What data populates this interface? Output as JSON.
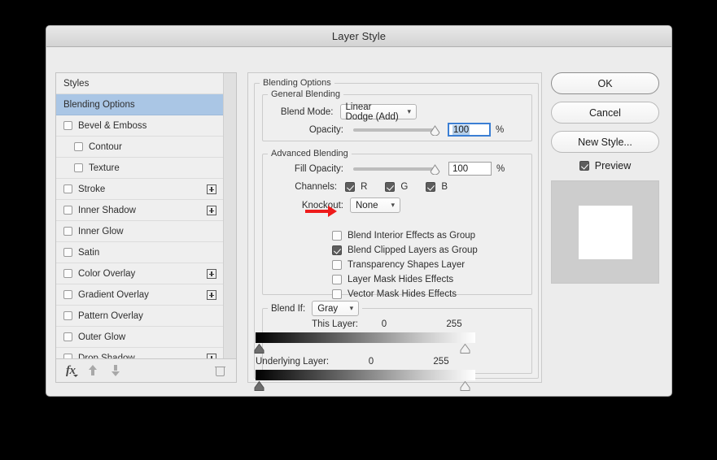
{
  "window": {
    "title": "Layer Style"
  },
  "sidebar": {
    "items": [
      {
        "label": "Styles",
        "type": "plain",
        "selected": false,
        "checkbox": false,
        "plus": false,
        "indent": false
      },
      {
        "label": "Blending Options",
        "type": "plain",
        "selected": true,
        "checkbox": false,
        "plus": false,
        "indent": false
      },
      {
        "label": "Bevel & Emboss",
        "type": "effect",
        "selected": false,
        "checkbox": true,
        "checked": false,
        "plus": false,
        "indent": false
      },
      {
        "label": "Contour",
        "type": "effect",
        "selected": false,
        "checkbox": true,
        "checked": false,
        "plus": false,
        "indent": true
      },
      {
        "label": "Texture",
        "type": "effect",
        "selected": false,
        "checkbox": true,
        "checked": false,
        "plus": false,
        "indent": true
      },
      {
        "label": "Stroke",
        "type": "effect",
        "selected": false,
        "checkbox": true,
        "checked": false,
        "plus": true,
        "indent": false
      },
      {
        "label": "Inner Shadow",
        "type": "effect",
        "selected": false,
        "checkbox": true,
        "checked": false,
        "plus": true,
        "indent": false
      },
      {
        "label": "Inner Glow",
        "type": "effect",
        "selected": false,
        "checkbox": true,
        "checked": false,
        "plus": false,
        "indent": false
      },
      {
        "label": "Satin",
        "type": "effect",
        "selected": false,
        "checkbox": true,
        "checked": false,
        "plus": false,
        "indent": false
      },
      {
        "label": "Color Overlay",
        "type": "effect",
        "selected": false,
        "checkbox": true,
        "checked": false,
        "plus": true,
        "indent": false
      },
      {
        "label": "Gradient Overlay",
        "type": "effect",
        "selected": false,
        "checkbox": true,
        "checked": false,
        "plus": true,
        "indent": false
      },
      {
        "label": "Pattern Overlay",
        "type": "effect",
        "selected": false,
        "checkbox": true,
        "checked": false,
        "plus": false,
        "indent": false
      },
      {
        "label": "Outer Glow",
        "type": "effect",
        "selected": false,
        "checkbox": true,
        "checked": false,
        "plus": false,
        "indent": false
      },
      {
        "label": "Drop Shadow",
        "type": "effect",
        "selected": false,
        "checkbox": true,
        "checked": false,
        "plus": true,
        "indent": false
      }
    ],
    "toolbar": {
      "fx_label": "fx",
      "move_up_label": "Move Up",
      "move_down_label": "Move Down",
      "delete_label": "Delete Effect"
    }
  },
  "blending_options": {
    "group_label": "Blending Options",
    "general": {
      "group_label": "General Blending",
      "blend_mode_label": "Blend Mode:",
      "blend_mode_value": "Linear Dodge (Add)",
      "opacity_label": "Opacity:",
      "opacity_value": "100",
      "opacity_unit": "%",
      "opacity_slider_pct": 100
    },
    "advanced": {
      "group_label": "Advanced Blending",
      "fill_opacity_label": "Fill Opacity:",
      "fill_opacity_value": "100",
      "fill_opacity_unit": "%",
      "fill_opacity_slider_pct": 100,
      "channels_label": "Channels:",
      "channels": [
        {
          "label": "R",
          "checked": true
        },
        {
          "label": "G",
          "checked": true
        },
        {
          "label": "B",
          "checked": true
        }
      ],
      "knockout_label": "Knockout:",
      "knockout_value": "None",
      "options": [
        {
          "label": "Blend Interior Effects as Group",
          "checked": false,
          "annotated": false
        },
        {
          "label": "Blend Clipped Layers as Group",
          "checked": true,
          "annotated": false
        },
        {
          "label": "Transparency Shapes Layer",
          "checked": false,
          "annotated": true
        },
        {
          "label": "Layer Mask Hides Effects",
          "checked": false,
          "annotated": false
        },
        {
          "label": "Vector Mask Hides Effects",
          "checked": false,
          "annotated": false
        }
      ]
    },
    "blend_if": {
      "group_label": "Blend If:",
      "channel_value": "Gray",
      "this_layer": {
        "label": "This Layer:",
        "min": "0",
        "max": "255"
      },
      "underlying_layer": {
        "label": "Underlying Layer:",
        "min": "0",
        "max": "255"
      }
    }
  },
  "actions": {
    "ok_label": "OK",
    "cancel_label": "Cancel",
    "new_style_label": "New Style...",
    "preview_label": "Preview",
    "preview_checked": true
  },
  "annotation": {
    "arrow_color": "#ee1b1b",
    "points_to": "Transparency Shapes Layer"
  }
}
